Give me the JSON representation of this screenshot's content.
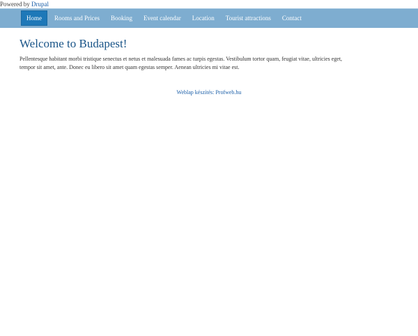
{
  "powered": {
    "prefix": "Powered by",
    "link": "Drupal"
  },
  "nav": {
    "items": [
      {
        "label": "Home"
      },
      {
        "label": "Rooms and Prices"
      },
      {
        "label": "Booking"
      },
      {
        "label": "Event calendar"
      },
      {
        "label": "Location"
      },
      {
        "label": "Tourist attractions"
      },
      {
        "label": "Contact"
      }
    ]
  },
  "main": {
    "title": "Welcome to Budapest!",
    "body": "Pellentesque habitant morbi tristique senectus et netus et malesuada fames ac turpis egestas. Vestibulum tortor quam, feugiat vitae, ultricies eget, tempor sit amet, ante. Donec eu libero sit amet quam egestas semper. Aenean ultricies mi vitae est."
  },
  "footer": {
    "credit": "Weblap készítés: Profweb.hu"
  },
  "colors": {
    "navbar": "#7eadd0",
    "active_tab": "#1e78b8",
    "title": "#1a5588",
    "link": "#1a5ea8"
  }
}
